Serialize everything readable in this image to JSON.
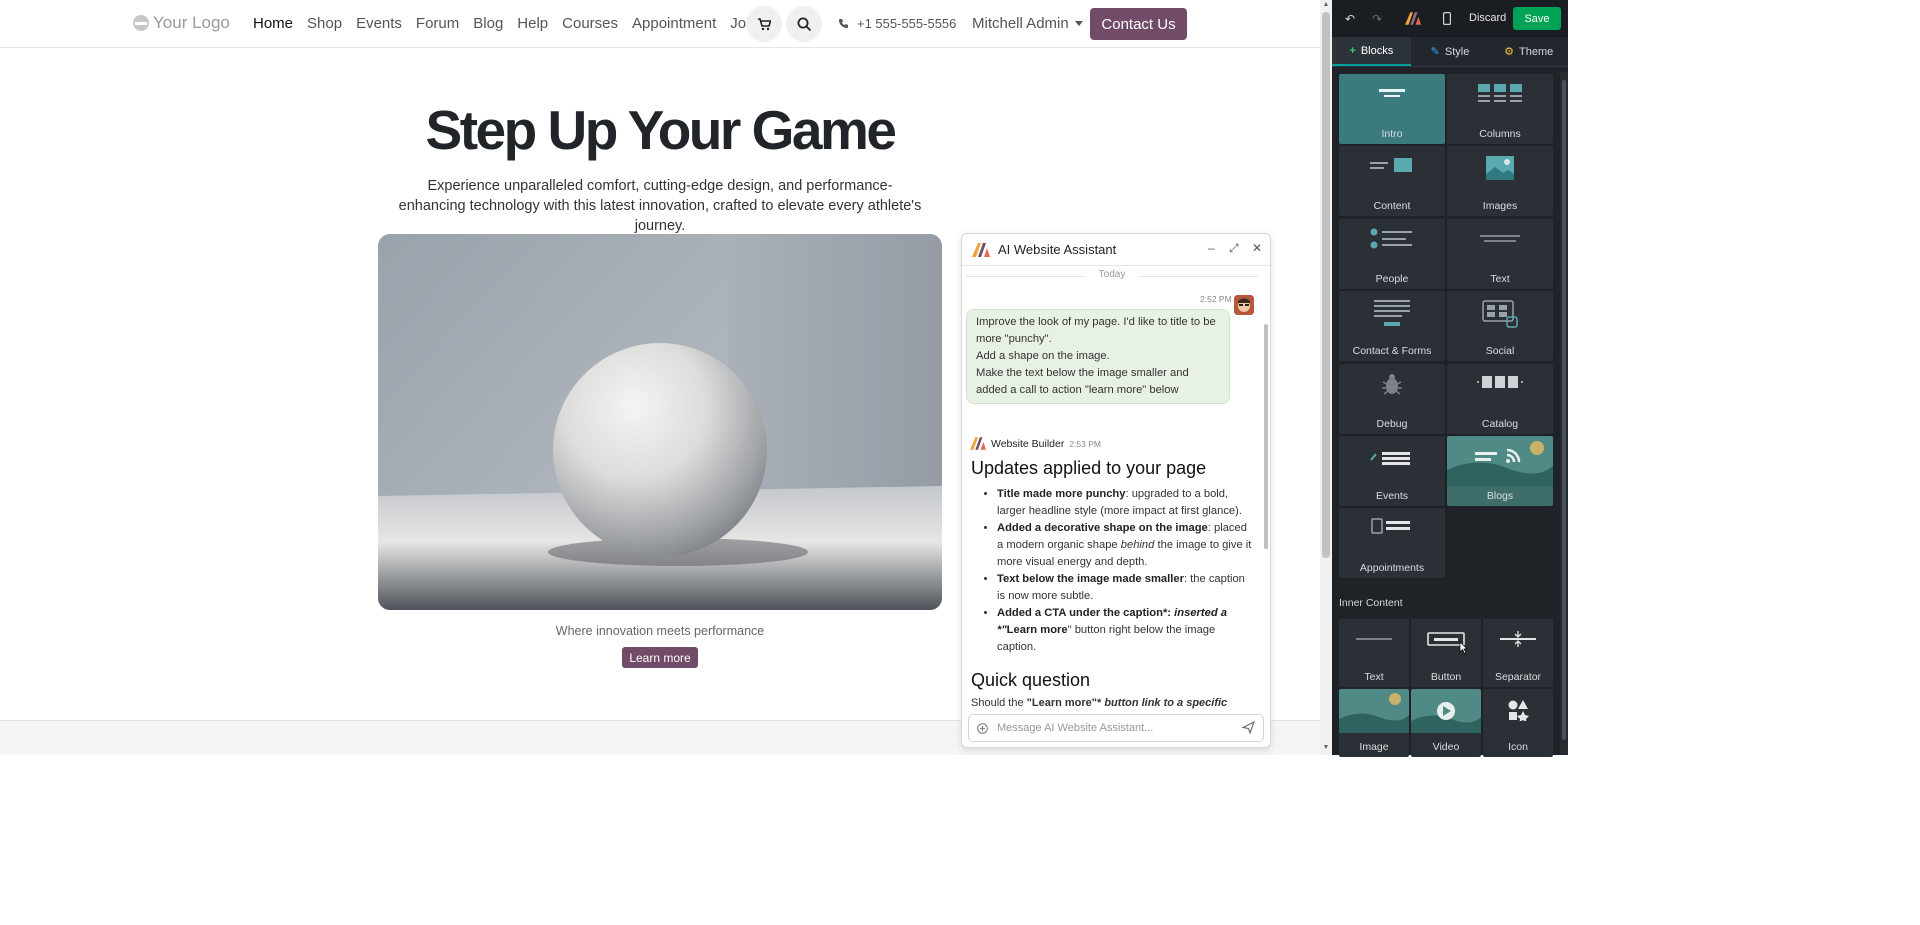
{
  "header": {
    "logo_text": "Your Logo",
    "nav": [
      "Home",
      "Shop",
      "Events",
      "Forum",
      "Blog",
      "Help",
      "Courses",
      "Appointment",
      "Jobs"
    ],
    "active_nav": "Home",
    "phone": "+1 555-555-5556",
    "user": "Mitchell Admin",
    "contact_label": "Contact Us"
  },
  "hero": {
    "title": "Step Up Your Game",
    "subtitle": "Experience unparalleled comfort, cutting-edge design, and performance-enhancing technology with this latest innovation, crafted to elevate every athlete's journey.",
    "caption": "Where innovation meets performance",
    "cta": "Learn more"
  },
  "chat": {
    "title": "AI Website Assistant",
    "day_divider": "Today",
    "user_time": "2:52 PM",
    "user_message": [
      "Improve the look of my page. I'd like to title to be more \"punchy\".",
      "Add a shape on the image.",
      "Make the text below the image smaller and added a call to action \"learn more\" below"
    ],
    "bot_name": "Website Builder",
    "bot_time": "2:53 PM",
    "bot_heading": "Updates applied to your page",
    "bot_items": [
      {
        "bold": "Title made more punchy",
        "rest": ": upgraded to a bold, larger headline style (more impact at first glance)."
      },
      {
        "bold": "Added a decorative shape on the image",
        "rest_before": ": placed a modern organic shape ",
        "italic": "behind",
        "rest_after": " the image to give it more visual energy and depth."
      },
      {
        "bold": "Text below the image made smaller",
        "rest": ": the caption is now more subtle."
      },
      {
        "bold": "Added a CTA under the caption*:",
        "italic_rest": " inserted a *\"",
        "bold2": "Learn more",
        "rest_after": "\" button right below the image caption."
      }
    ],
    "bot_heading2": "Quick question",
    "bot_question_start": "Should the ",
    "bot_question_bold": "\"Learn more\"*",
    "bot_question_rest": " button link to a specific",
    "input_placeholder": "Message AI Website Assistant..."
  },
  "builder": {
    "discard": "Discard",
    "save": "Save",
    "tabs": [
      "Blocks",
      "Style",
      "Theme"
    ],
    "active_tab": "Blocks",
    "blocks": [
      "Intro",
      "Columns",
      "Content",
      "Images",
      "People",
      "Text",
      "Contact & Forms",
      "Social",
      "Debug",
      "Catalog",
      "Events",
      "Blogs",
      "Appointments"
    ],
    "inner_content_title": "Inner Content",
    "inner": [
      "Text",
      "Button",
      "Separator",
      "Image",
      "Video",
      "Icon"
    ]
  },
  "colors": {
    "brand": "#714b67",
    "save": "#00a355",
    "accent_teal": "#00a09d"
  }
}
